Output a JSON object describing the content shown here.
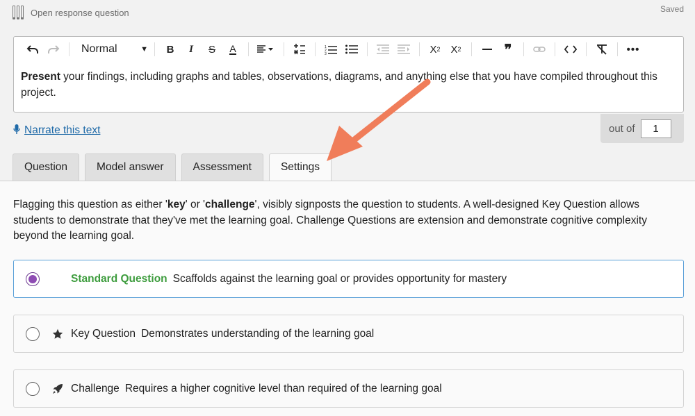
{
  "header": {
    "title": "Open response question",
    "status": "Saved"
  },
  "toolbar": {
    "format_select": "Normal",
    "buttons": [
      "undo",
      "redo",
      "bold",
      "italic",
      "strikethrough",
      "text-color",
      "align",
      "math",
      "ordered-list",
      "bullet-list",
      "outdent",
      "indent",
      "subscript",
      "superscript",
      "horizontal-rule",
      "blockquote",
      "link",
      "code",
      "clear-formatting",
      "more"
    ]
  },
  "editor": {
    "bold_word": "Present",
    "text": " your findings, including graphs and tables, observations, diagrams, and anything else that you have compiled throughout this project."
  },
  "narrate": {
    "label": "Narrate this text"
  },
  "score": {
    "label": "out of",
    "value": "1"
  },
  "tabs": [
    {
      "label": "Question",
      "active": false
    },
    {
      "label": "Model answer",
      "active": false
    },
    {
      "label": "Assessment",
      "active": false
    },
    {
      "label": "Settings",
      "active": true
    }
  ],
  "settings": {
    "description": {
      "p1": "Flagging this question as either '",
      "key": "key",
      "p2": "' or '",
      "challenge": "challenge",
      "p3": "', visibly signposts the question to students. A well-designed Key Question allows students to demonstrate that they've met the learning goal. Challenge Questions are extension and demonstrate cognitive complexity beyond the learning goal."
    },
    "options": [
      {
        "title": "Standard Question",
        "description": "Scaffolds against the learning goal or provides opportunity for mastery",
        "selected": true,
        "icon": "none"
      },
      {
        "title": "Key Question",
        "description": "Demonstrates understanding of the learning goal",
        "selected": false,
        "icon": "star-icon"
      },
      {
        "title": "Challenge",
        "description": "Requires a higher cognitive level than required of the learning goal",
        "selected": false,
        "icon": "rocket-icon"
      }
    ]
  },
  "colors": {
    "accent": "#1f6aa8",
    "selected_border": "#5aa0d8",
    "standard_green": "#3d9c3d",
    "radio_purple": "#8e4cb3",
    "annotation_arrow": "#f07d5a"
  }
}
